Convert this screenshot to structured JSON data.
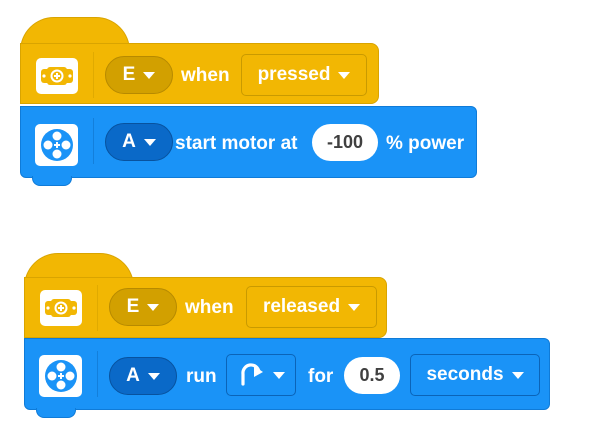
{
  "stack1": {
    "hat": {
      "icon": "force-sensor-icon",
      "port": "E",
      "when_label": "when",
      "state": "pressed"
    },
    "action": {
      "icon": "motor-icon",
      "port": "A",
      "text": "start motor at",
      "power_value": "-100",
      "suffix": "% power"
    }
  },
  "stack2": {
    "hat": {
      "icon": "force-sensor-icon",
      "port": "E",
      "when_label": "when",
      "state": "released"
    },
    "action": {
      "icon": "motor-icon",
      "port": "A",
      "run_label": "run",
      "direction_icon": "clockwise-arrow-icon",
      "for_label": "for",
      "duration_value": "0.5",
      "unit": "seconds"
    }
  },
  "colors": {
    "event_yellow": "#F2B703",
    "motor_blue": "#1A93F7",
    "white": "#FFFFFF"
  }
}
